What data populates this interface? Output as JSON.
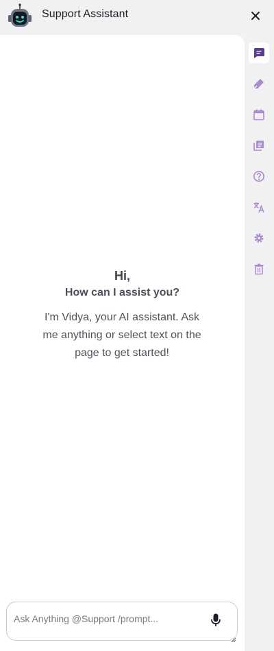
{
  "header": {
    "title": "Support Assistant",
    "logo_icon": "robot-icon",
    "close_icon": "close-icon"
  },
  "greeting": {
    "hi": "Hi,",
    "subtitle": "How can I assist you?",
    "intro": "I'm Vidya, your AI assistant. Ask me anything or select text on the page to get started!"
  },
  "composer": {
    "placeholder": "Ask Anything @Support /prompt...",
    "value": "",
    "mic_icon": "microphone-icon"
  },
  "sidebar": {
    "items": [
      {
        "id": "chat",
        "icon": "chat-icon",
        "active": true
      },
      {
        "id": "edit",
        "icon": "pen-icon",
        "active": false
      },
      {
        "id": "calendar",
        "icon": "calendar-icon",
        "active": false
      },
      {
        "id": "library",
        "icon": "library-icon",
        "active": false
      },
      {
        "id": "help",
        "icon": "help-icon",
        "active": false
      },
      {
        "id": "translate",
        "icon": "translate-icon",
        "active": false
      },
      {
        "id": "settings",
        "icon": "gear-icon",
        "active": false
      },
      {
        "id": "delete",
        "icon": "trash-icon",
        "active": false
      }
    ]
  },
  "colors": {
    "accent": "#5b3a98",
    "icon_muted": "#a98ad0",
    "background": "#f1f1f2",
    "panel": "#ffffff"
  }
}
